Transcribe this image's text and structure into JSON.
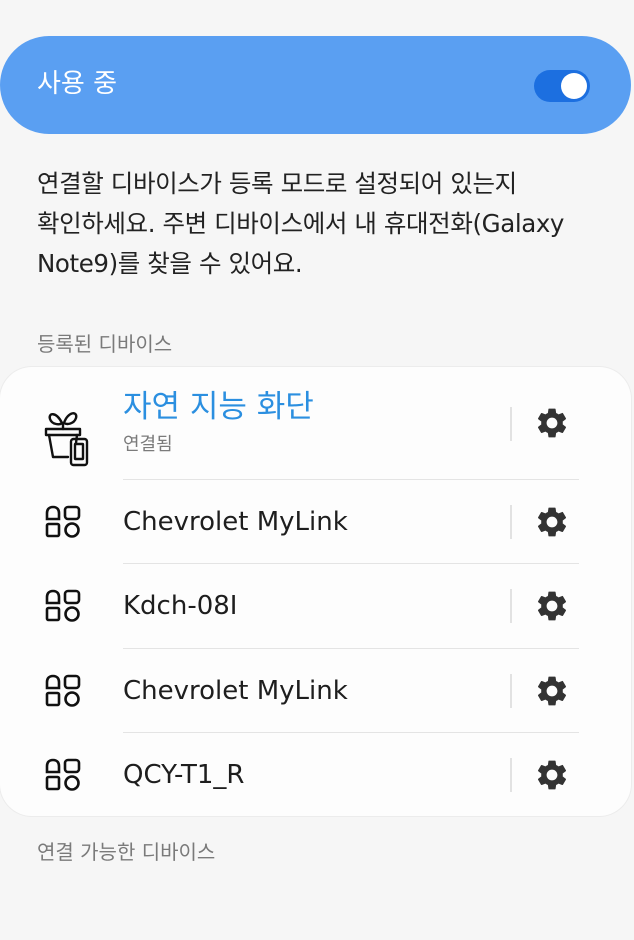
{
  "toggle": {
    "label": "사용 중",
    "enabled": true,
    "accent": "#5a9ff2",
    "switch_color": "#1c6fe0"
  },
  "description": {
    "lines": [
      "연결할 디바이스가 등록 모드로 설정되어 있는지",
      "확인하세요. 주변 디바이스에서 내 휴대전화(Galaxy",
      "Note9)를 찾을 수 있어요."
    ]
  },
  "registered": {
    "header": "등록된 디바이스",
    "devices": [
      {
        "name": "자연 지능 화단",
        "status": "연결됨",
        "icon": "plant-pot-phone-icon",
        "connected": true
      },
      {
        "name": "Chevrolet MyLink",
        "icon": "generic-device-icon"
      },
      {
        "name": "Kdch-08I",
        "icon": "generic-device-icon"
      },
      {
        "name": "Chevrolet MyLink",
        "icon": "generic-device-icon"
      },
      {
        "name": "QCY-T1_R",
        "icon": "generic-device-icon"
      }
    ]
  },
  "available": {
    "header": "연결 가능한 디바이스"
  },
  "colors": {
    "connected_text": "#2b8fe0"
  }
}
